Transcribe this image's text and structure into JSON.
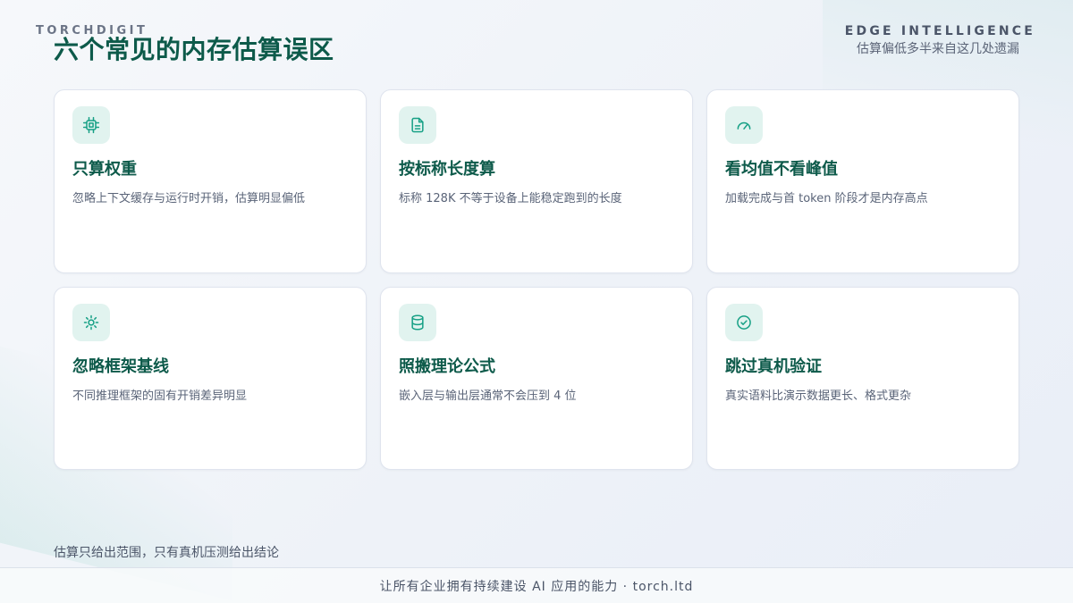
{
  "brand": "TORCHDIGIT",
  "title": "六个常见的内存估算误区",
  "header_right": {
    "label": "EDGE INTELLIGENCE",
    "subtitle": "估算偏低多半来自这几处遗漏"
  },
  "accent_color": "#0d5a4a",
  "icon_color": "#16a085",
  "cards": [
    {
      "icon": "chip-icon",
      "title": "只算权重",
      "desc": "忽略上下文缓存与运行时开销，估算明显偏低"
    },
    {
      "icon": "document-icon",
      "title": "按标称长度算",
      "desc": "标称 128K 不等于设备上能稳定跑到的长度"
    },
    {
      "icon": "gauge-icon",
      "title": "看均值不看峰值",
      "desc": "加载完成与首 token 阶段才是内存高点"
    },
    {
      "icon": "sun-icon",
      "title": "忽略框架基线",
      "desc": "不同推理框架的固有开销差异明显"
    },
    {
      "icon": "database-icon",
      "title": "照搬理论公式",
      "desc": "嵌入层与输出层通常不会压到 4 位"
    },
    {
      "icon": "check-circle-icon",
      "title": "跳过真机验证",
      "desc": "真实语料比演示数据更长、格式更杂"
    }
  ],
  "footnote": "估算只给出范围，只有真机压测给出结论",
  "footer": "让所有企业拥有持续建设 AI 应用的能力 · torch.ltd"
}
